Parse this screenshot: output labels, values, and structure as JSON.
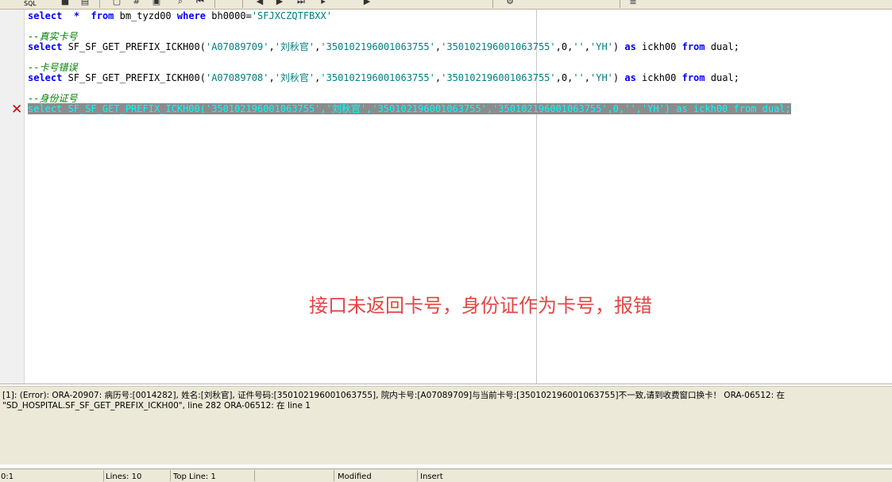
{
  "toolbar": {
    "sql_label": "SQL",
    "buttons": [
      {
        "name": "save-icon",
        "glyph": "■"
      },
      {
        "name": "print-icon",
        "glyph": "▤"
      },
      {
        "name": "explain-icon",
        "glyph": "▢"
      },
      {
        "name": "fx-icon",
        "glyph": "#"
      },
      {
        "name": "execute-icon",
        "glyph": "▣"
      },
      {
        "name": "find-icon",
        "glyph": "⌕"
      },
      {
        "name": "first-icon",
        "glyph": "⏮"
      },
      {
        "name": "prev-icon",
        "glyph": "◀"
      },
      {
        "name": "next-icon",
        "glyph": "▶"
      },
      {
        "name": "last-icon",
        "glyph": "⏭"
      },
      {
        "name": "step-icon",
        "glyph": "▸"
      },
      {
        "name": "run-icon",
        "glyph": "▶"
      },
      {
        "name": "tools-icon",
        "glyph": "⚙"
      },
      {
        "name": "layers-icon",
        "glyph": "≣"
      }
    ]
  },
  "editor": {
    "lines": [
      {
        "type": "code",
        "segments": [
          {
            "t": "kw",
            "v": "select"
          },
          {
            "t": "plain",
            "v": "  "
          },
          {
            "t": "kw",
            "v": "*"
          },
          {
            "t": "plain",
            "v": "  "
          },
          {
            "t": "kw",
            "v": "from"
          },
          {
            "t": "plain",
            "v": " bm_tyzd00 "
          },
          {
            "t": "kw",
            "v": "where"
          },
          {
            "t": "plain",
            "v": " bh0000="
          },
          {
            "t": "str",
            "v": "'SFJXCZQTFBXX'"
          }
        ]
      },
      {
        "type": "blank",
        "segments": []
      },
      {
        "type": "comment",
        "segments": [
          {
            "t": "cm",
            "v": "--真实卡号"
          }
        ]
      },
      {
        "type": "code",
        "segments": [
          {
            "t": "kw",
            "v": "select"
          },
          {
            "t": "plain",
            "v": " SF_SF_GET_PREFIX_ICKH00("
          },
          {
            "t": "str",
            "v": "'A07089709'"
          },
          {
            "t": "plain",
            "v": ","
          },
          {
            "t": "str",
            "v": "'刘秋官'"
          },
          {
            "t": "plain",
            "v": ","
          },
          {
            "t": "str",
            "v": "'350102196001063755'"
          },
          {
            "t": "plain",
            "v": ","
          },
          {
            "t": "str",
            "v": "'350102196001063755'"
          },
          {
            "t": "plain",
            "v": ",0,"
          },
          {
            "t": "str",
            "v": "''"
          },
          {
            "t": "plain",
            "v": ","
          },
          {
            "t": "str",
            "v": "'YH'"
          },
          {
            "t": "plain",
            "v": ") "
          },
          {
            "t": "kw",
            "v": "as"
          },
          {
            "t": "plain",
            "v": " ickh00 "
          },
          {
            "t": "kw",
            "v": "from"
          },
          {
            "t": "plain",
            "v": " dual;"
          }
        ]
      },
      {
        "type": "blank",
        "segments": []
      },
      {
        "type": "comment",
        "segments": [
          {
            "t": "cm",
            "v": "--卡号错误"
          }
        ]
      },
      {
        "type": "code",
        "segments": [
          {
            "t": "kw",
            "v": "select"
          },
          {
            "t": "plain",
            "v": " SF_SF_GET_PREFIX_ICKH00("
          },
          {
            "t": "str",
            "v": "'A07089708'"
          },
          {
            "t": "plain",
            "v": ","
          },
          {
            "t": "str",
            "v": "'刘秋官'"
          },
          {
            "t": "plain",
            "v": ","
          },
          {
            "t": "str",
            "v": "'350102196001063755'"
          },
          {
            "t": "plain",
            "v": ","
          },
          {
            "t": "str",
            "v": "'350102196001063755'"
          },
          {
            "t": "plain",
            "v": ",0,"
          },
          {
            "t": "str",
            "v": "''"
          },
          {
            "t": "plain",
            "v": ","
          },
          {
            "t": "str",
            "v": "'YH'"
          },
          {
            "t": "plain",
            "v": ") "
          },
          {
            "t": "kw",
            "v": "as"
          },
          {
            "t": "plain",
            "v": " ickh00 "
          },
          {
            "t": "kw",
            "v": "from"
          },
          {
            "t": "plain",
            "v": " dual;"
          }
        ]
      },
      {
        "type": "blank",
        "segments": []
      },
      {
        "type": "comment",
        "segments": [
          {
            "t": "cm",
            "v": "--身份证号"
          }
        ]
      },
      {
        "type": "selected",
        "segments": [
          {
            "t": "plain",
            "v": "select SF_SF_GET_PREFIX_ICKH00('350102196001063755','刘秋官','350102196001063755','350102196001063755',0,'','YH') as ickh00 from dual;"
          }
        ]
      }
    ],
    "error_marker": "✕",
    "annotation": "接口未返回卡号，身份证作为卡号，报错"
  },
  "output": {
    "message": "[1]: (Error): ORA-20907: 病历号:[0014282], 姓名:[刘秋官], 证件号码:[350102196001063755], 院内卡号:[A07089709]与当前卡号:[350102196001063755]不一致,请到收费窗口换卡！ ORA-06512: 在 \"SD_HOSPITAL.SF_SF_GET_PREFIX_ICKH00\", line 282 ORA-06512: 在 line 1"
  },
  "statusbar": {
    "position": "0:1",
    "lines": "Lines: 10",
    "top_line": "Top Line: 1",
    "modified": "Modified",
    "mode": "Insert"
  }
}
